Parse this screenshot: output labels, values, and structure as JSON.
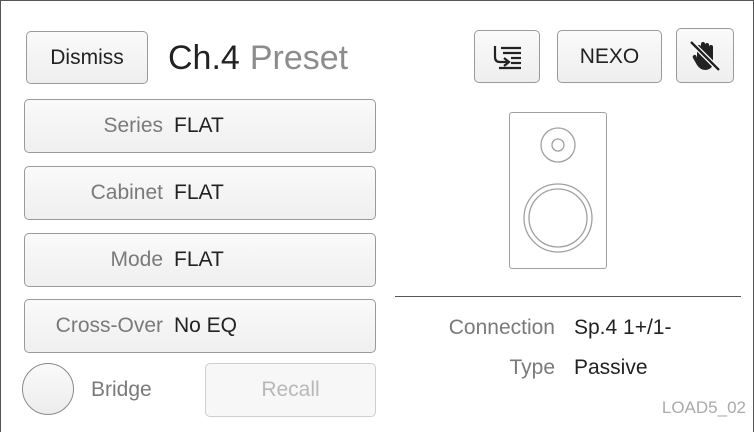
{
  "header": {
    "dismiss_label": "Dismiss",
    "channel": "Ch.4",
    "preset_word": "Preset",
    "brand_label": "NEXO"
  },
  "fields": [
    {
      "label": "Series",
      "value": "FLAT"
    },
    {
      "label": "Cabinet",
      "value": "FLAT"
    },
    {
      "label": "Mode",
      "value": "FLAT"
    },
    {
      "label": "Cross-Over",
      "value": "No EQ"
    }
  ],
  "bridge": {
    "label": "Bridge"
  },
  "recall_label": "Recall",
  "info": {
    "connection_label": "Connection",
    "connection_value": "Sp.4 1+/1-",
    "type_label": "Type",
    "type_value": "Passive"
  },
  "screen_code": "LOAD5_02",
  "icons": {
    "list": "list-arrow-icon",
    "mute": "hand-mute-icon",
    "speaker": "speaker-cabinet-icon"
  },
  "colors": {
    "label_gray": "#7a7a7a",
    "border": "#9a9a9a",
    "disabled": "#b8b8b8"
  }
}
